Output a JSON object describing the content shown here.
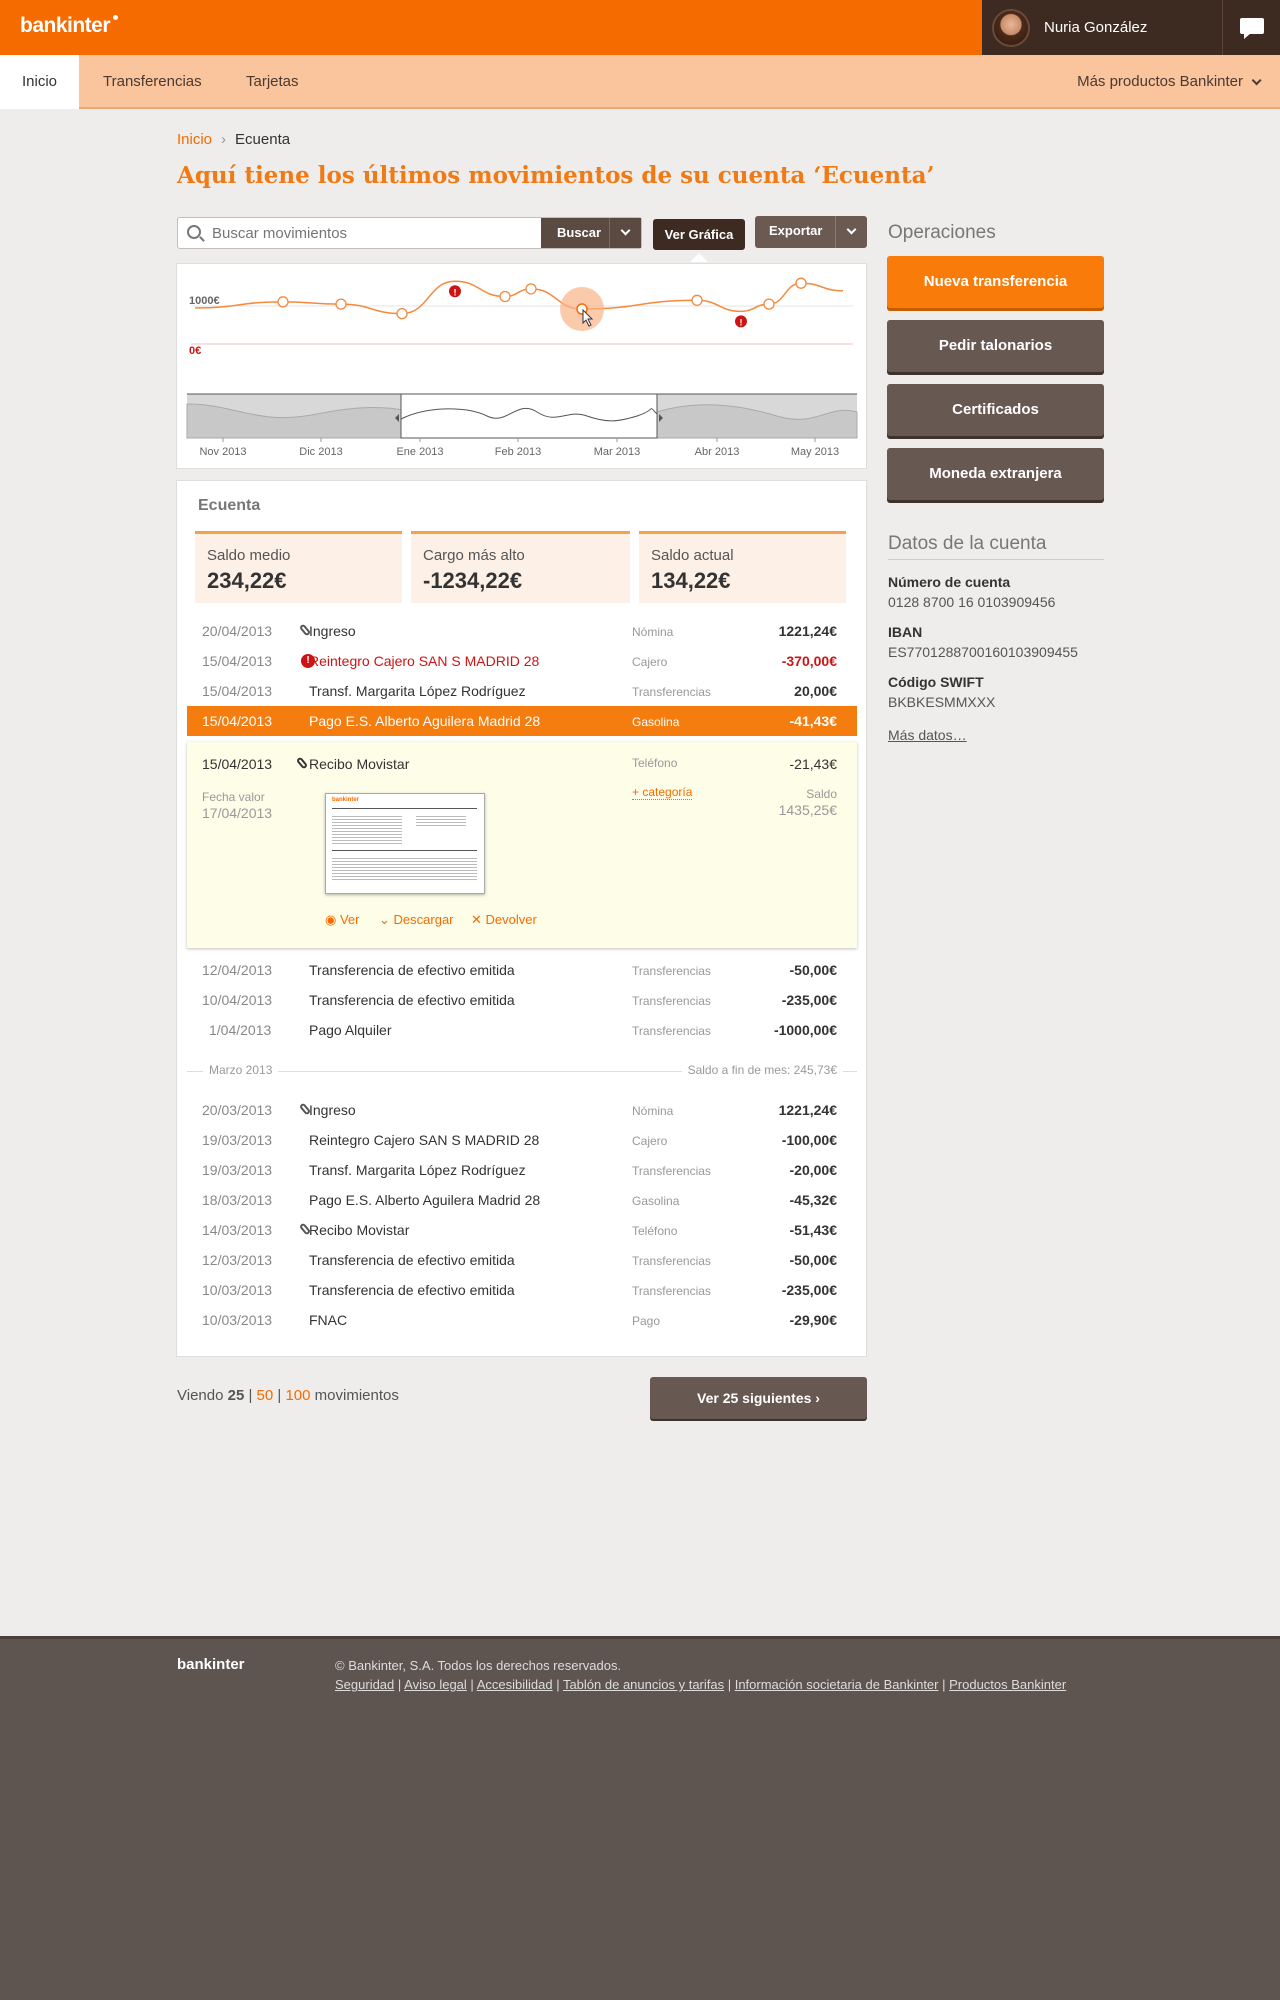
{
  "header": {
    "logo": "bankinter",
    "user_name": "Nuria González"
  },
  "nav": {
    "tabs": [
      "Inicio",
      "Transferencias",
      "Tarjetas"
    ],
    "more": "Más productos Bankinter"
  },
  "breadcrumb": {
    "home": "Inicio",
    "current": "Ecuenta"
  },
  "page_title": "Aquí tiene los últimos movimientos de su cuenta ‘Ecuenta’",
  "search": {
    "placeholder": "Buscar movimientos",
    "button": "Buscar"
  },
  "toolbar": {
    "graph": "Ver Gráfica",
    "export": "Exportar"
  },
  "chart_data": {
    "type": "line",
    "y_labels": [
      "1000€",
      "0€"
    ],
    "x_labels": [
      "Nov 2013",
      "Dic 2013",
      "Ene 2013",
      "Feb 2013",
      "Mar 2013",
      "Abr 2013",
      "May 2013"
    ],
    "values": [
      950,
      1110,
      1050,
      800,
      1650,
      1250,
      1450,
      920,
      1150,
      860,
      1050,
      1600,
      1400
    ],
    "alerts": 2
  },
  "account": {
    "name": "Ecuenta",
    "stats": [
      {
        "label": "Saldo medio",
        "value": "234,22€"
      },
      {
        "label": "Cargo más alto",
        "value": "-1234,22€"
      },
      {
        "label": "Saldo actual",
        "value": "134,22€"
      }
    ]
  },
  "transactions_april": [
    {
      "date": "20/04/2013",
      "desc": "Ingreso",
      "cat": "Nómina",
      "amount": "1221,24€"
    },
    {
      "date": "15/04/2013",
      "desc": "Reintegro Cajero SAN S MADRID 28",
      "cat": "Cajero",
      "amount": "-370,00€"
    },
    {
      "date": "15/04/2013",
      "desc": "Transf. Margarita López Rodríguez",
      "cat": "Transferencias",
      "amount": "20,00€"
    },
    {
      "date": "15/04/2013",
      "desc": "Pago E.S. Alberto Aguilera Madrid 28",
      "cat": "Gasolina",
      "amount": "-41,43€"
    }
  ],
  "detail": {
    "date": "15/04/2013",
    "desc": "Recibo Movistar",
    "cat": "Teléfono",
    "amount": "-21,43€",
    "value_date_label": "Fecha valor",
    "value_date": "17/04/2013",
    "add_category": "+ categoría",
    "balance_label": "Saldo",
    "balance": "1435,25€",
    "actions": [
      "Ver",
      "Descargar",
      "Devolver"
    ],
    "doc_logo": "bankinter"
  },
  "transactions_april_2": [
    {
      "date": "12/04/2013",
      "desc": "Transferencia de efectivo emitida",
      "cat": "Transferencias",
      "amount": "-50,00€"
    },
    {
      "date": "10/04/2013",
      "desc": "Transferencia de efectivo emitida",
      "cat": "Transferencias",
      "amount": "-235,00€"
    },
    {
      "date": "1/04/2013",
      "desc": "Pago Alquiler",
      "cat": "Transferencias",
      "amount": "-1000,00€"
    }
  ],
  "month_divider": {
    "label": "Marzo 2013",
    "balance": "Saldo a fin de mes: 245,73€"
  },
  "transactions_march": [
    {
      "date": "20/03/2013",
      "desc": "Ingreso",
      "cat": "Nómina",
      "amount": "1221,24€"
    },
    {
      "date": "19/03/2013",
      "desc": "Reintegro Cajero SAN S MADRID 28",
      "cat": "Cajero",
      "amount": "-100,00€"
    },
    {
      "date": "19/03/2013",
      "desc": "Transf. Margarita López Rodríguez",
      "cat": "Transferencias",
      "amount": "-20,00€"
    },
    {
      "date": "18/03/2013",
      "desc": "Pago E.S. Alberto Aguilera Madrid 28",
      "cat": "Gasolina",
      "amount": "-45,32€"
    },
    {
      "date": "14/03/2013",
      "desc": "Recibo Movistar",
      "cat": "Teléfono",
      "amount": "-51,43€"
    },
    {
      "date": "12/03/2013",
      "desc": "Transferencia de efectivo emitida",
      "cat": "Transferencias",
      "amount": "-50,00€"
    },
    {
      "date": "10/03/2013",
      "desc": "Transferencia de efectivo emitida",
      "cat": "Transferencias",
      "amount": "-235,00€"
    },
    {
      "date": "10/03/2013",
      "desc": "FNAC",
      "cat": "Pago",
      "amount": "-29,90€"
    }
  ],
  "pager": {
    "prefix": "Viendo",
    "current": "25",
    "opt1": "50",
    "opt2": "100",
    "suffix": "movimientos",
    "next": "Ver 25 siguientes ›"
  },
  "sidebar": {
    "ops_title": "Operaciones",
    "ops": [
      "Nueva transferencia",
      "Pedir talonarios",
      "Certificados",
      "Moneda extranjera"
    ],
    "acc_title": "Datos de la cuenta",
    "fields": [
      {
        "label": "Número de cuenta",
        "value": "0128 8700 16 0103909456"
      },
      {
        "label": "IBAN",
        "value": "ES7701288700160103909455"
      },
      {
        "label": "Código SWIFT",
        "value": "BKBKESMMXXX"
      }
    ],
    "more": "Más datos…"
  },
  "footer": {
    "logo": "bankinter",
    "copyright": "© Bankinter, S.A. Todos los derechos reservados.",
    "links": [
      "Seguridad",
      "Aviso legal",
      "Accesibilidad",
      "Tablón de anuncios y tarifas",
      "Información societaria de Bankinter",
      "Productos Bankinter"
    ]
  },
  "colors": {
    "brand": "#f56b00",
    "dark": "#3d2b22",
    "button": "#685852",
    "alert": "#cc1414"
  }
}
